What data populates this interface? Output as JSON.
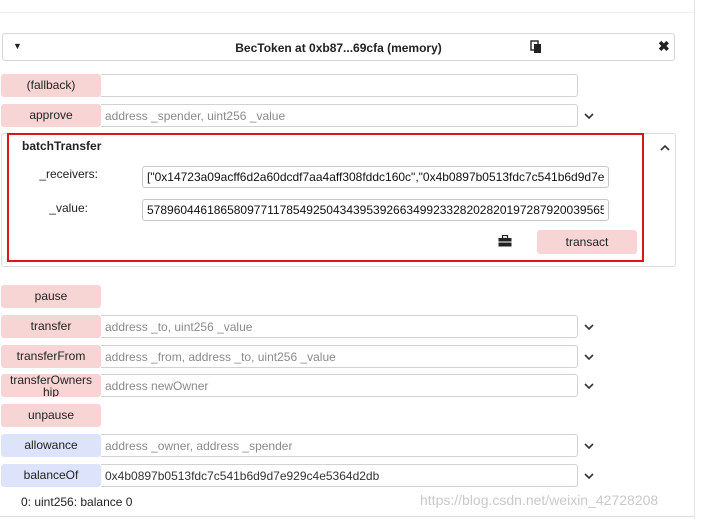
{
  "contract": {
    "title": "BecToken at 0xb87...69cfa (memory)"
  },
  "functions": {
    "fallback": {
      "label": "(fallback)",
      "placeholder": ""
    },
    "approve": {
      "label": "approve",
      "placeholder": "address _spender, uint256 _value"
    },
    "pause": {
      "label": "pause"
    },
    "transfer": {
      "label": "transfer",
      "placeholder": "address _to, uint256 _value"
    },
    "transferFrom": {
      "label": "transferFrom",
      "placeholder": "address _from, address _to, uint256 _value"
    },
    "transferOwnership": {
      "label": "transferOwners hip",
      "placeholder": "address newOwner"
    },
    "unpause": {
      "label": "unpause"
    },
    "allowance": {
      "label": "allowance",
      "placeholder": "address _owner, address _spender"
    },
    "balanceOf": {
      "label": "balanceOf",
      "value": "0x4b0897b0513fdc7c541b6d9d7e929c4e5364d2db"
    }
  },
  "batchTransfer": {
    "title": "batchTransfer",
    "receivers_label": "_receivers:",
    "receivers_value": "[\"0x14723a09acff6d2a60dcdf7aa4aff308fddc160c\",\"0x4b0897b0513fdc7c541b6d9d7e",
    "value_label": "_value:",
    "value_value": "578960446186580977117854925043439539266349923328202820197287920039565",
    "transact_label": "transact"
  },
  "result": {
    "text": "0: uint256: balance 0"
  },
  "watermark": "https://blog.csdn.net/weixin_42728208"
}
